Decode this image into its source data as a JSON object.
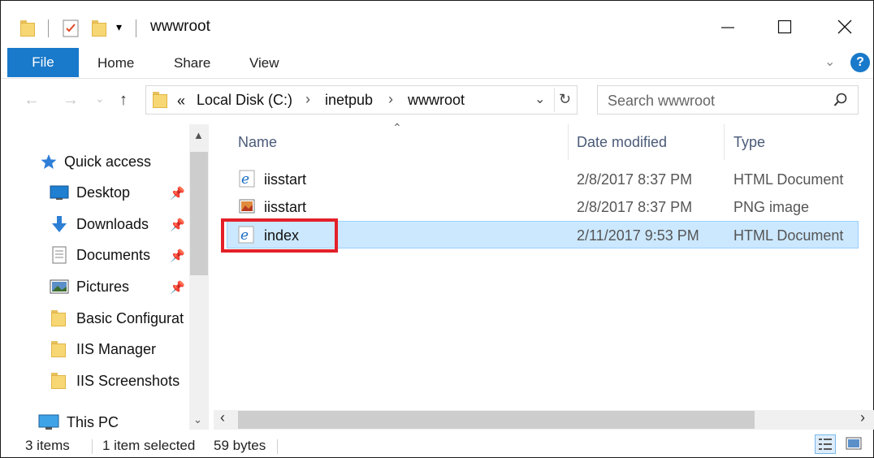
{
  "window": {
    "title": "wwwroot"
  },
  "ribbon": {
    "tabs": [
      "File",
      "Home",
      "Share",
      "View"
    ]
  },
  "address": {
    "overflow": "«",
    "crumbs": [
      "Local Disk (C:)",
      "inetpub",
      "wwwroot"
    ],
    "search_placeholder": "Search wwwroot"
  },
  "nav": {
    "quick_access": "Quick access",
    "items": [
      {
        "label": "Desktop",
        "icon": "desktop-icon",
        "pinned": true
      },
      {
        "label": "Downloads",
        "icon": "downloads-icon",
        "pinned": true
      },
      {
        "label": "Documents",
        "icon": "documents-icon",
        "pinned": true
      },
      {
        "label": "Pictures",
        "icon": "pictures-icon",
        "pinned": true
      },
      {
        "label": "Basic Configurat",
        "icon": "folder-icon",
        "pinned": false
      },
      {
        "label": "IIS Manager",
        "icon": "folder-icon",
        "pinned": false
      },
      {
        "label": "IIS Screenshots",
        "icon": "folder-icon",
        "pinned": false
      }
    ],
    "this_pc": "This PC"
  },
  "columns": {
    "name": "Name",
    "date": "Date modified",
    "type": "Type"
  },
  "files": [
    {
      "name": "iisstart",
      "date": "2/8/2017 8:37 PM",
      "type": "HTML Document",
      "icon": "ie-html-icon",
      "selected": false
    },
    {
      "name": "iisstart",
      "date": "2/8/2017 8:37 PM",
      "type": "PNG image",
      "icon": "png-image-icon",
      "selected": false
    },
    {
      "name": "index",
      "date": "2/11/2017 9:53 PM",
      "type": "HTML Document",
      "icon": "ie-html-icon",
      "selected": true
    }
  ],
  "status": {
    "items": "3 items",
    "selected": "1 item selected",
    "size": "59 bytes"
  },
  "colors": {
    "accent": "#1979ca",
    "selection": "#cce8ff",
    "highlight": "#e3202a"
  }
}
